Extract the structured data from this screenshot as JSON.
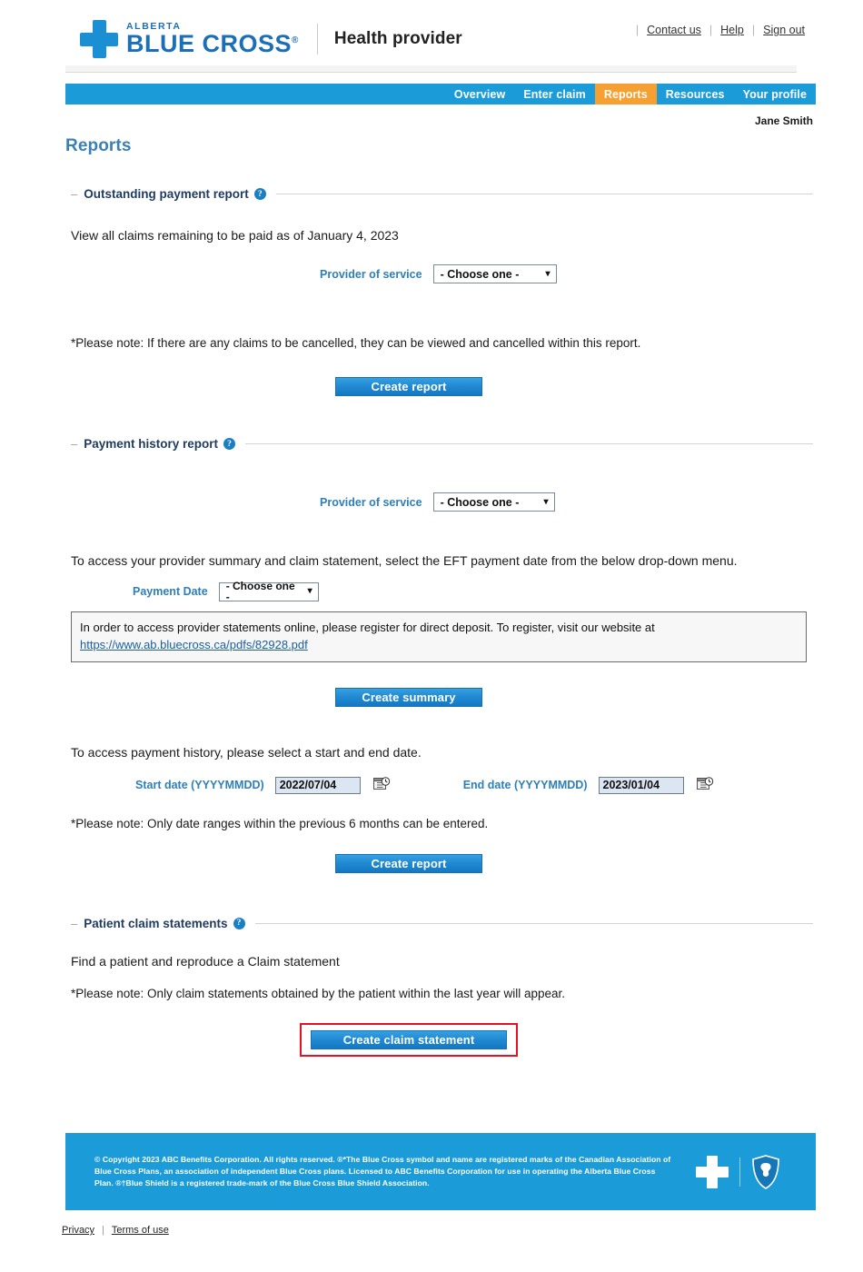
{
  "header": {
    "logo_alberta": "ALBERTA",
    "logo_bluecross": "BLUE CROSS",
    "logo_reg": "®",
    "tagline": "Health provider",
    "toplinks": [
      {
        "label": "Contact us"
      },
      {
        "label": "Help"
      },
      {
        "label": "Sign out"
      }
    ]
  },
  "nav": {
    "items": [
      {
        "label": "Overview",
        "active": false
      },
      {
        "label": "Enter claim",
        "active": false
      },
      {
        "label": "Reports",
        "active": true
      },
      {
        "label": "Resources",
        "active": false
      },
      {
        "label": "Your profile",
        "active": false
      }
    ],
    "active_color": "#F5A030",
    "bar_color": "#1B9BD8"
  },
  "user": {
    "name": "Jane Smith"
  },
  "page": {
    "title": "Reports"
  },
  "sections": {
    "outstanding": {
      "title": "Outstanding payment report",
      "help": "?",
      "description": "View all claims remaining to be paid as of January 4, 2023",
      "provider_label": "Provider of service",
      "provider_value": "- Choose one -",
      "note": "*Please note: If there are any claims to be cancelled, they can be viewed and cancelled within this report.",
      "button": "Create report"
    },
    "payment_history": {
      "title": "Payment history report",
      "help": "?",
      "provider_label": "Provider of service",
      "provider_value": "- Choose one -",
      "eft_text": "To access your provider summary and claim statement, select the EFT payment date from the below drop-down menu.",
      "payment_date_label": "Payment Date",
      "payment_date_value": "- Choose one -",
      "notice_text": "In order to access provider statements online, please register for direct deposit. To register, visit our website at",
      "notice_link": "https://www.ab.bluecross.ca/pdfs/82928.pdf",
      "summary_button": "Create summary",
      "range_text": "To access payment history, please select a start and end date.",
      "start_label": "Start date (YYYYMMDD)",
      "start_value": "2022/07/04",
      "end_label": "End date (YYYYMMDD)",
      "end_value": "2023/01/04",
      "range_note": "*Please note: Only date ranges within the previous 6 months can be entered.",
      "report_button": "Create report"
    },
    "patient_claim": {
      "title": "Patient claim statements",
      "help": "?",
      "description": "Find a patient and reproduce a Claim statement",
      "note": "*Please note: Only claim statements obtained by the patient within the last year will appear.",
      "button": "Create claim statement",
      "highlight_color": "#E81123"
    }
  },
  "footer": {
    "copyright": "© Copyright 2023 ABC Benefits Corporation. All rights reserved. ®*The Blue Cross symbol and name are registered marks of the Canadian Association of Blue Cross Plans, an association of independent Blue Cross plans. Licensed to ABC Benefits Corporation for use in operating the Alberta Blue Cross Plan. ®†Blue Shield is a registered trade-mark of the Blue Cross Blue Shield Association.",
    "links": [
      {
        "label": "Privacy"
      },
      {
        "label": "Terms of use"
      }
    ]
  }
}
